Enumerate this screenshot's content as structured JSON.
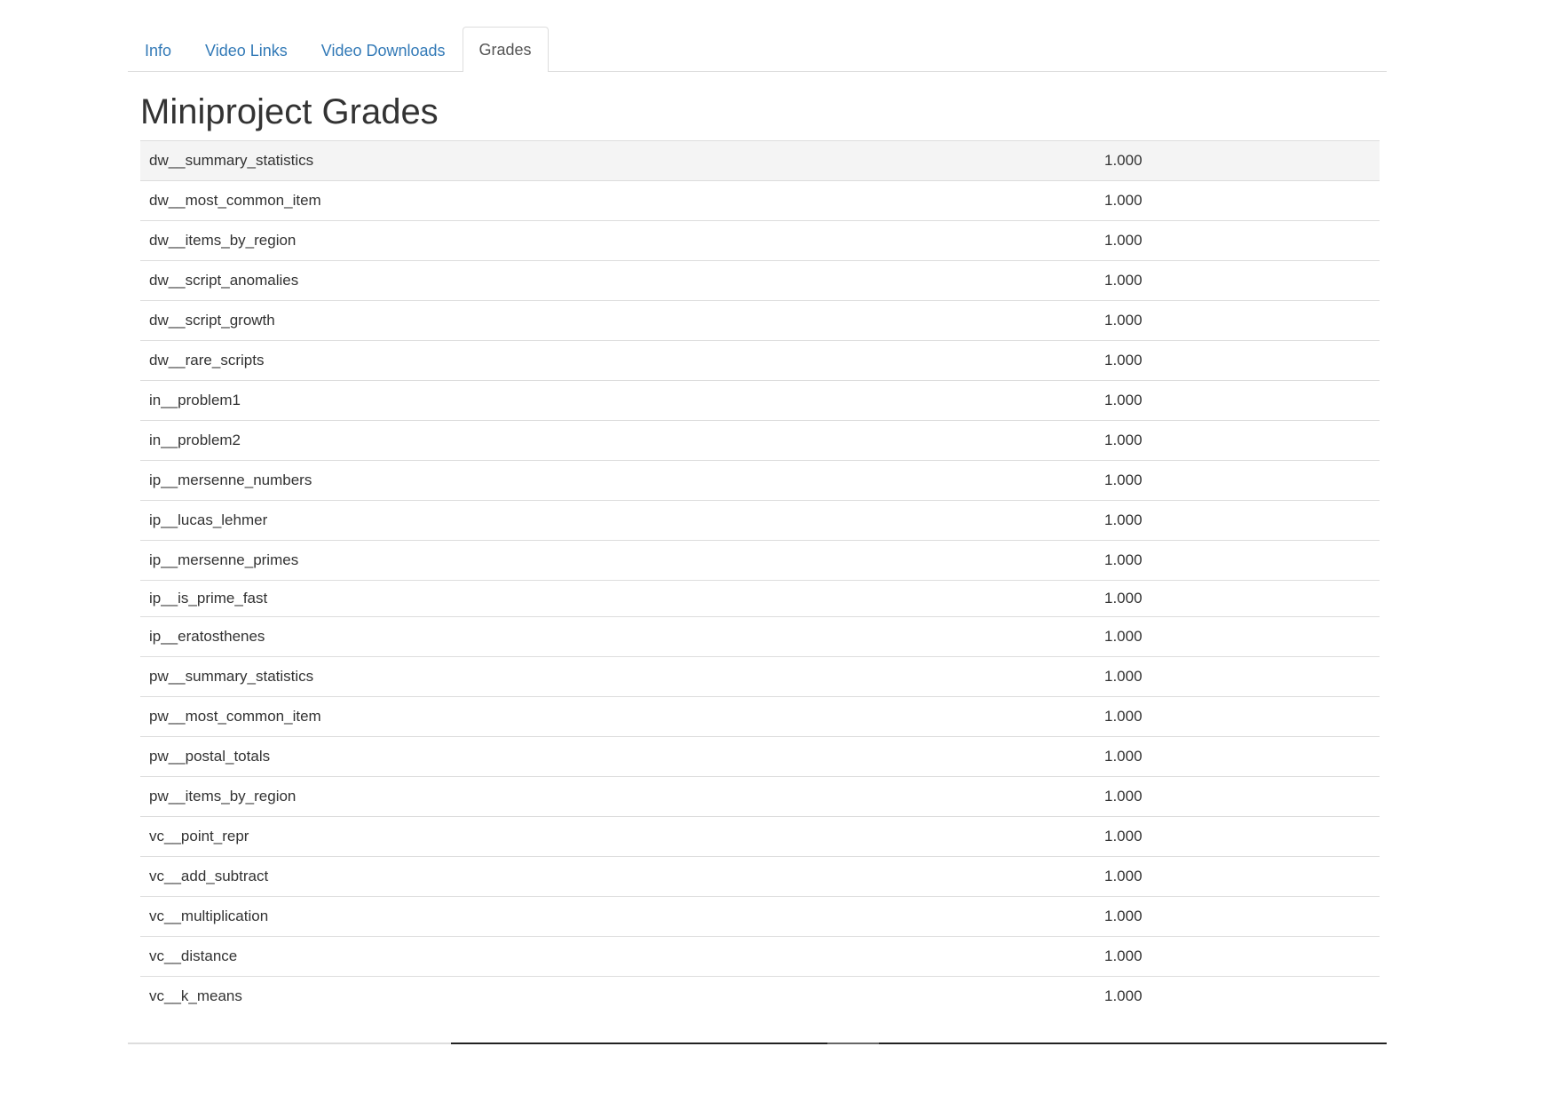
{
  "tabs": [
    {
      "label": "Info",
      "active": false
    },
    {
      "label": "Video Links",
      "active": false
    },
    {
      "label": "Video Downloads",
      "active": false
    },
    {
      "label": "Grades",
      "active": true
    }
  ],
  "page_title": "Miniproject Grades",
  "grades": [
    {
      "name": "dw__summary_statistics",
      "score": "1.000"
    },
    {
      "name": "dw__most_common_item",
      "score": "1.000"
    },
    {
      "name": "dw__items_by_region",
      "score": "1.000"
    },
    {
      "name": "dw__script_anomalies",
      "score": "1.000"
    },
    {
      "name": "dw__script_growth",
      "score": "1.000"
    },
    {
      "name": "dw__rare_scripts",
      "score": "1.000"
    },
    {
      "name": "in__problem1",
      "score": "1.000"
    },
    {
      "name": "in__problem2",
      "score": "1.000"
    },
    {
      "name": "ip__mersenne_numbers",
      "score": "1.000"
    },
    {
      "name": "ip__lucas_lehmer",
      "score": "1.000"
    },
    {
      "name": "ip__mersenne_primes",
      "score": "1.000"
    },
    {
      "name": "ip__is_prime_fast",
      "score": "1.000"
    },
    {
      "name": "ip__eratosthenes",
      "score": "1.000"
    },
    {
      "name": "pw__summary_statistics",
      "score": "1.000"
    },
    {
      "name": "pw__most_common_item",
      "score": "1.000"
    },
    {
      "name": "pw__postal_totals",
      "score": "1.000"
    },
    {
      "name": "pw__items_by_region",
      "score": "1.000"
    },
    {
      "name": "vc__point_repr",
      "score": "1.000"
    },
    {
      "name": "vc__add_subtract",
      "score": "1.000"
    },
    {
      "name": "vc__multiplication",
      "score": "1.000"
    },
    {
      "name": "vc__distance",
      "score": "1.000"
    },
    {
      "name": "vc__k_means",
      "score": "1.000"
    }
  ]
}
